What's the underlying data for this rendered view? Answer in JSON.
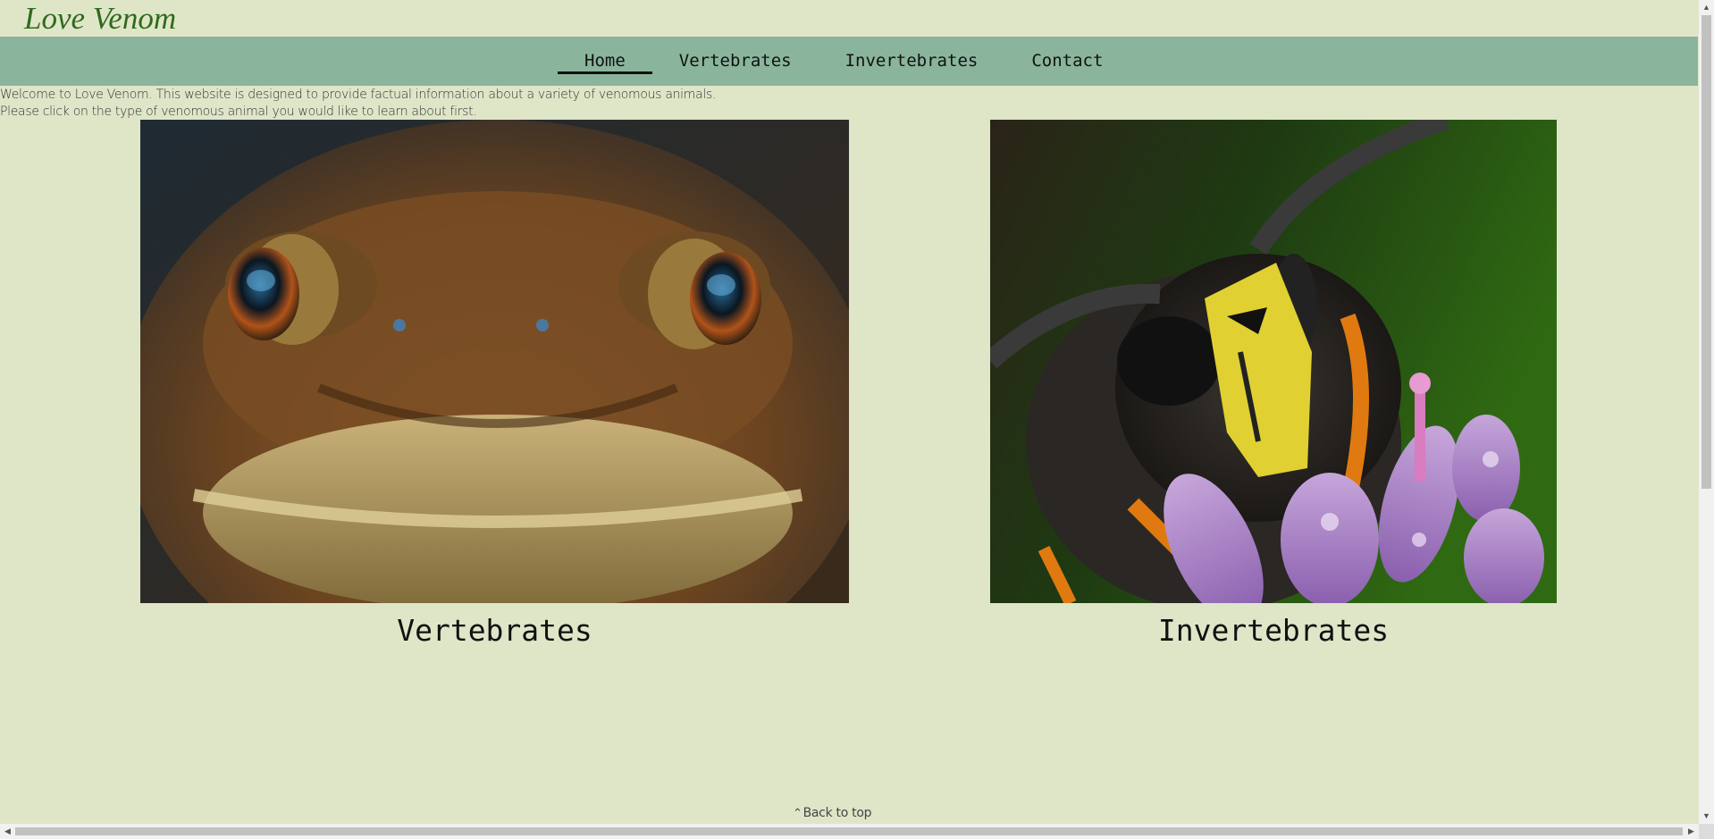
{
  "site": {
    "title": "Love Venom"
  },
  "nav": {
    "items": [
      {
        "label": "Home",
        "active": true
      },
      {
        "label": "Vertebrates",
        "active": false
      },
      {
        "label": "Invertebrates",
        "active": false
      },
      {
        "label": "Contact",
        "active": false
      }
    ]
  },
  "intro": {
    "line1": "Welcome to Love Venom. This website is designed to provide factual information about a variety of venomous animals.",
    "line2": "Please click on the type of venomous animal you would like to learn about first."
  },
  "cards": [
    {
      "caption": "Vertebrates",
      "image": "toad-photo"
    },
    {
      "caption": "Invertebrates",
      "image": "wasp-photo"
    }
  ],
  "footer": {
    "back_to_top": "Back to top",
    "icon": "double-chevron-up-icon"
  },
  "colors": {
    "background": "#dfe6c8",
    "nav": "#8ab59c",
    "title": "#2f6a1c"
  }
}
